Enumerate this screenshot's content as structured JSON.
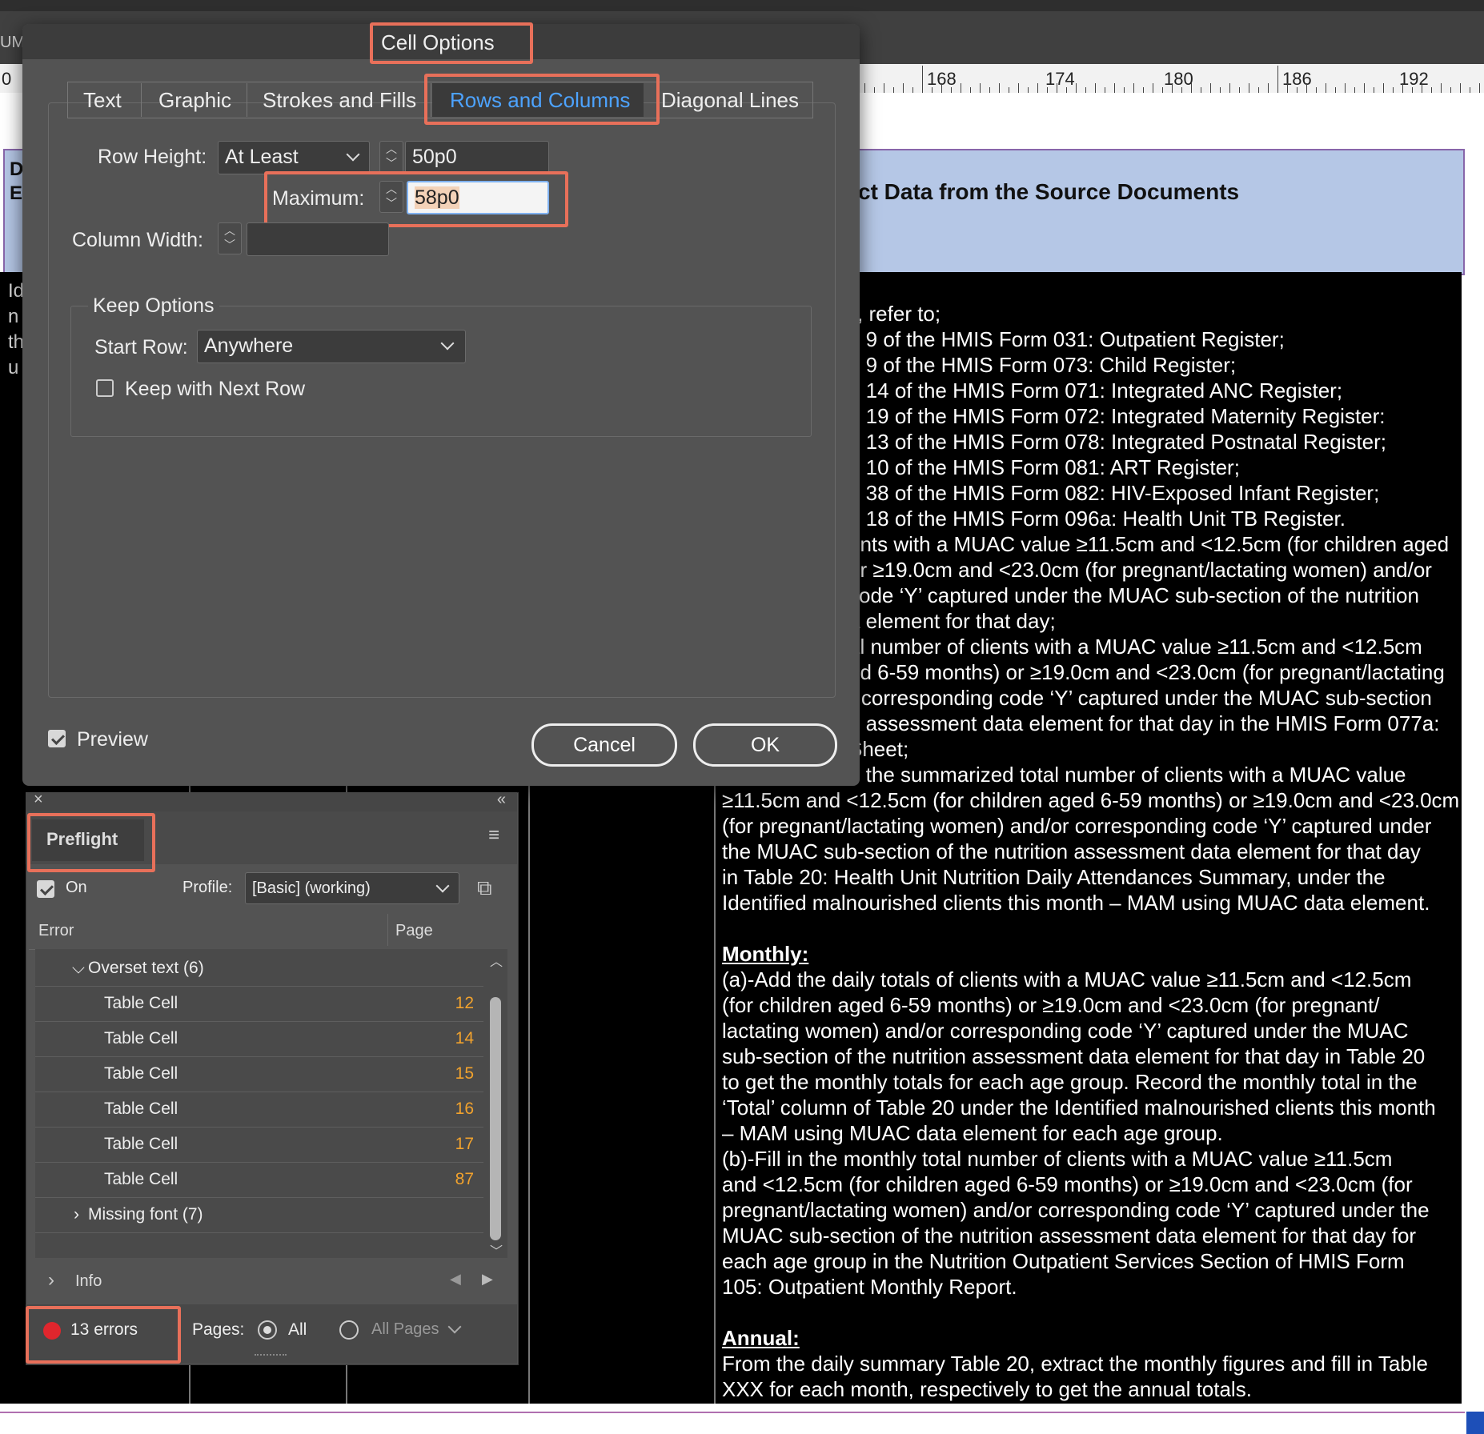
{
  "ruler": {
    "labels": [
      "0",
      "168",
      "174",
      "180",
      "186",
      "192"
    ]
  },
  "document": {
    "header_title": "ct Data from the Source Documents",
    "body_lines": [
      "y, refer to;",
      "n 9 of the HMIS Form 031: Outpatient Register;",
      "n 9 of the HMIS Form 073: Child Register;",
      "n 14 of the HMIS Form 071: Integrated ANC Register;",
      "n 19 of the HMIS Form 072: Integrated Maternity Register:",
      "n 13 of the HMIS Form 078: Integrated Postnatal Register;",
      "n 10 of the HMIS Form 081: ART Register;",
      "n 38 of the HMIS Form 082: HIV-Exposed Infant Register;",
      "n 18 of the HMIS Form 096a: Health Unit TB Register.",
      "ents with a MUAC value ≥11.5cm and <12.5cm (for children aged",
      "or ≥19.0cm and <23.0cm (for pregnant/lactating women) and/or",
      "code ‘Y’ captured under the MUAC sub-section of the nutrition",
      "a element for that day;",
      "al number of clients with a MUAC value ≥11.5cm and <12.5cm",
      "ed 6-59 months) or ≥19.0cm and <23.0cm (for pregnant/lactating",
      "r corresponding code ‘Y’ captured under the MUAC sub-section",
      "n assessment data element for that day in the HMIS Form 077a:",
      "Sheet;",
      "d the summarized total number of clients with a MUAC value",
      "≥11.5cm and <12.5cm (for children aged 6-59 months) or ≥19.0cm and <23.0cm",
      "(for pregnant/lactating women) and/or corresponding code ‘Y’ captured under",
      "the MUAC sub-section of the nutrition assessment data element for that day",
      "in Table 20: Health Unit Nutrition Daily Attendances Summary, under the",
      "Identified malnourished clients this month – MAM using MUAC data element.",
      "",
      "Monthly:",
      "(a)-Add the daily totals of clients with a MUAC value ≥11.5cm and <12.5cm",
      "(for children aged 6-59 months) or ≥19.0cm and <23.0cm (for pregnant/",
      "lactating women) and/or corresponding code ‘Y’ captured under the MUAC",
      "sub-section of the nutrition assessment data element for that day in Table 20",
      "to get the monthly totals for each age group. Record the monthly total in the",
      "‘Total’ column of Table 20 under the Identified malnourished clients this month",
      "– MAM using MUAC data element for each age group.",
      "(b)-Fill in the monthly total number of clients with a MUAC value ≥11.5cm",
      "and <12.5cm (for children aged 6-59 months) or ≥19.0cm and <23.0cm (for",
      "pregnant/lactating women) and/or corresponding code ‘Y’ captured under the",
      "MUAC sub-section of the nutrition assessment data element for that day for",
      "each age group in the Nutrition Outpatient Services Section of HMIS Form",
      "105: Outpatient Monthly Report.",
      "",
      "Annual:",
      "From the daily summary Table 20, extract the monthly figures and fill in Table",
      "XXX for each month, respectively to get the annual totals."
    ],
    "left_header_letters": [
      "D",
      "E"
    ],
    "left_body_letters": [
      "Id",
      "n",
      "th",
      "u"
    ]
  },
  "dialog": {
    "title": "Cell Options",
    "tabs": [
      "Text",
      "Graphic",
      "Strokes and Fills",
      "Rows and Columns",
      "Diagonal Lines"
    ],
    "active_tab": "Rows and Columns",
    "row_height_label": "Row Height:",
    "row_height_mode": "At Least",
    "row_height_value": "50p0",
    "maximum_label": "Maximum:",
    "maximum_value": "58p0",
    "column_width_label": "Column Width:",
    "column_width_value": "",
    "keep_options_label": "Keep Options",
    "start_row_label": "Start Row:",
    "start_row_value": "Anywhere",
    "keep_with_next_label": "Keep with Next Row",
    "keep_with_next_checked": false,
    "preview_label": "Preview",
    "preview_checked": true,
    "cancel_label": "Cancel",
    "ok_label": "OK"
  },
  "preflight": {
    "title": "Preflight",
    "on_label": "On",
    "on_checked": true,
    "profile_label": "Profile:",
    "profile_value": "[Basic] (working)",
    "col_error": "Error",
    "col_page": "Page",
    "group_overset": "Overset text (6)",
    "items": [
      {
        "label": "Table Cell",
        "page": "12"
      },
      {
        "label": "Table Cell",
        "page": "14"
      },
      {
        "label": "Table Cell",
        "page": "15"
      },
      {
        "label": "Table Cell",
        "page": "16"
      },
      {
        "label": "Table Cell",
        "page": "17"
      },
      {
        "label": "Table Cell",
        "page": "87"
      }
    ],
    "group_missing_font": "Missing font (7)",
    "info_label": "Info",
    "errors_label": "13 errors",
    "pages_label": "Pages:",
    "pages_all": "All",
    "pages_select": "All Pages"
  },
  "colors": {
    "highlight": "#e8705a",
    "error_red": "#e0262d",
    "page_orange": "#f1a22d",
    "header_blue": "#b5c7e6",
    "active_tab_text": "#4da3ff"
  }
}
